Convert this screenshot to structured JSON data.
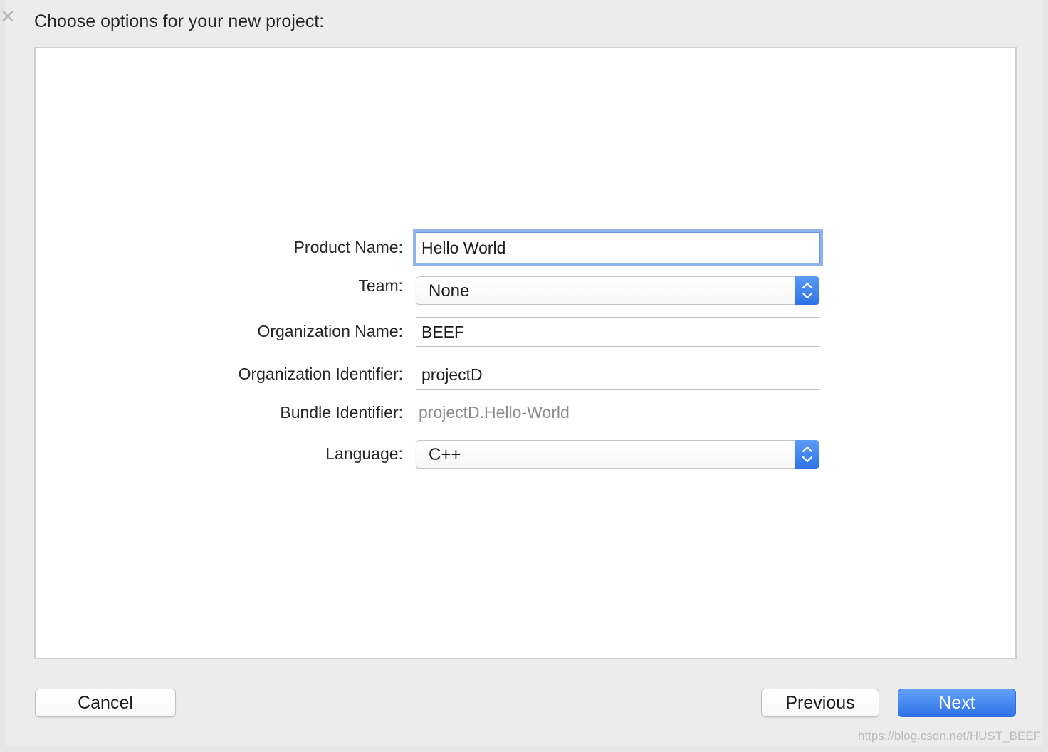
{
  "header": {
    "title": "Choose options for your new project:"
  },
  "form": {
    "product_name": {
      "label": "Product Name:",
      "value": "Hello World"
    },
    "team": {
      "label": "Team:",
      "value": "None"
    },
    "organization_name": {
      "label": "Organization Name:",
      "value": "BEEF"
    },
    "organization_identifier": {
      "label": "Organization Identifier:",
      "value": "projectD"
    },
    "bundle_identifier": {
      "label": "Bundle Identifier:",
      "value": "projectD.Hello-World"
    },
    "language": {
      "label": "Language:",
      "value": "C++"
    }
  },
  "footer": {
    "cancel_label": "Cancel",
    "previous_label": "Previous",
    "next_label": "Next"
  },
  "watermark": "https://blog.csdn.net/HUST_BEEF",
  "colors": {
    "accent": "#3478f6",
    "focus_ring": "#8fb3ef",
    "secondary_text": "#8c8c8c"
  },
  "icons": {
    "corner": "close-icon",
    "popup_stepper": "chevron-up-down-icon"
  }
}
